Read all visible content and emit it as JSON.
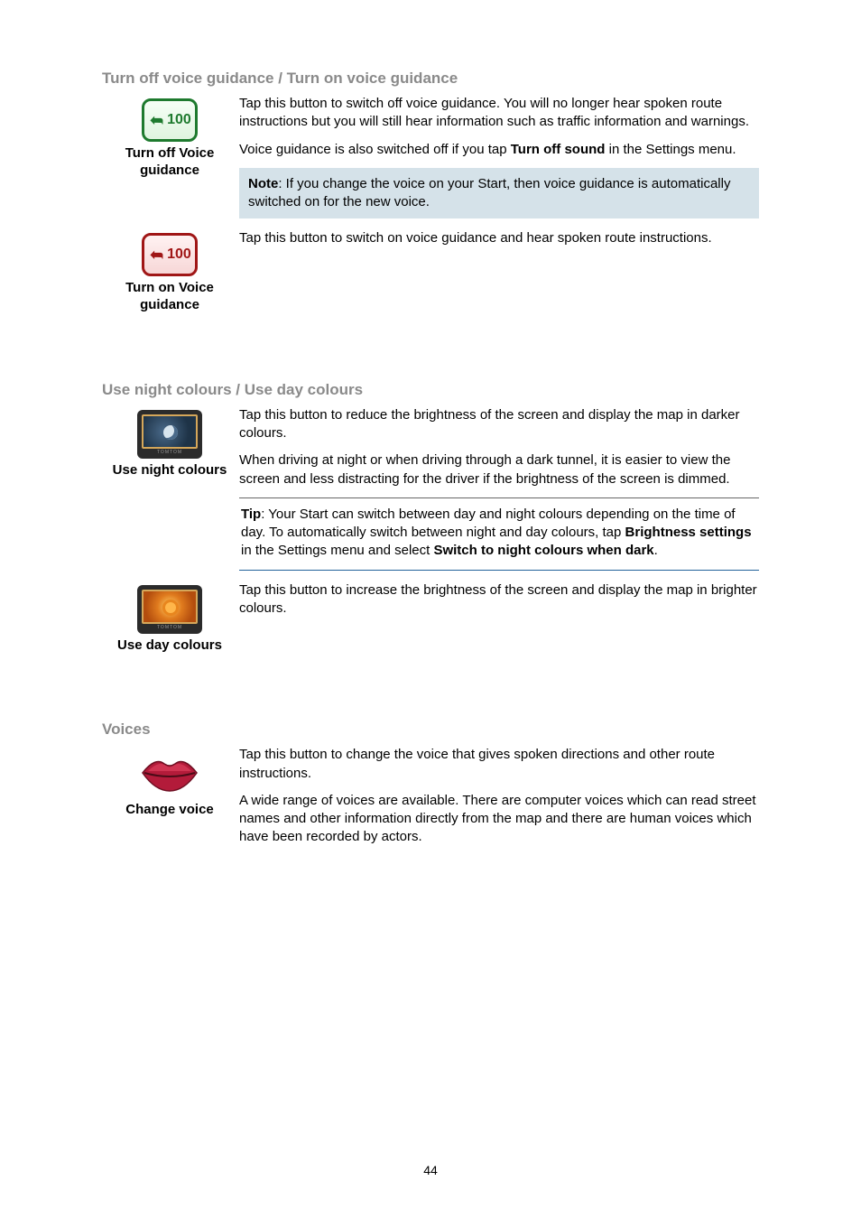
{
  "sections": {
    "voice_guidance": {
      "heading": "Turn off voice guidance / Turn on voice guidance",
      "turn_off": {
        "number": "100",
        "caption_line1": "Turn off Voice",
        "caption_line2": "guidance",
        "para1": "Tap this button to switch off voice guidance. You will no longer hear spoken route instructions but you will still hear information such as traffic information and warnings.",
        "para2_prefix": "Voice guidance is also switched off if you tap ",
        "para2_bold": "Turn off sound",
        "para2_suffix": " in the Settings menu.",
        "note_label": "Note",
        "note_text": ": If you change the voice on your Start, then voice guidance is automatically switched on for the new voice."
      },
      "turn_on": {
        "number": "100",
        "caption_line1": "Turn on Voice",
        "caption_line2": "guidance",
        "para1": "Tap this button to switch on voice guidance and hear spoken route instructions."
      }
    },
    "colours": {
      "heading": "Use night colours / Use day colours",
      "night": {
        "caption": "Use night colours",
        "para1": "Tap this button to reduce the brightness of the screen and display the map in darker colours.",
        "para2": "When driving at night or when driving through a dark tunnel, it is easier to view the screen and less distracting for the driver if the brightness of the screen is dimmed.",
        "tip_label": "Tip",
        "tip_text_1": ": Your Start can switch between day and night colours depending on the time of day. To automatically switch between night and day colours, tap ",
        "tip_bold_1": "Brightness settings",
        "tip_text_2": " in the Settings menu and select ",
        "tip_bold_2": "Switch to night colours when dark",
        "tip_text_3": "."
      },
      "day": {
        "caption": "Use day colours",
        "para1": "Tap this button to increase the brightness of the screen and display the map in brighter colours."
      }
    },
    "voices": {
      "heading": "Voices",
      "change": {
        "caption": "Change voice",
        "para1": "Tap this button to change the voice that gives spoken directions and other route instructions.",
        "para2": "A wide range of voices are available. There are computer voices which can read street names and other information directly from the map and there are human voices which have been recorded by actors."
      }
    }
  },
  "page_number": "44"
}
